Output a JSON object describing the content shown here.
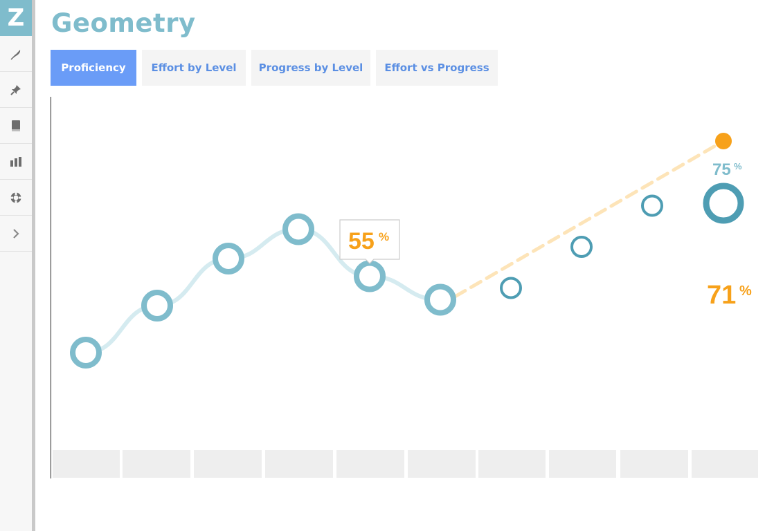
{
  "app": {
    "logo_letter": "Z"
  },
  "page_title": "Geometry",
  "sidebar": {
    "items": [
      {
        "icon": "feather-icon"
      },
      {
        "icon": "pin-icon"
      },
      {
        "icon": "book-icon"
      },
      {
        "icon": "bar-chart-icon"
      },
      {
        "icon": "lifebuoy-icon"
      },
      {
        "icon": "chevron-right-icon"
      }
    ]
  },
  "tabs": [
    {
      "label": "Proficiency",
      "active": true
    },
    {
      "label": "Effort by Level",
      "active": false
    },
    {
      "label": "Progress by Level",
      "active": false
    },
    {
      "label": "Effort vs Progress",
      "active": false
    }
  ],
  "chart_data": {
    "type": "line",
    "series": [
      {
        "role": "actual",
        "values": [
          35,
          43,
          51,
          56,
          48,
          44
        ],
        "color": "#7fbccc"
      },
      {
        "role": "projected",
        "values": [
          46,
          53,
          60,
          71
        ],
        "color": "#f7a11a"
      },
      {
        "role": "target",
        "values": [
          46,
          53,
          60,
          75
        ],
        "color": "#4e9db3"
      }
    ],
    "tooltip": {
      "value": "55",
      "unit": "%"
    },
    "end_labels": {
      "target": {
        "value": "75",
        "unit": "%",
        "color": "#7fbccc"
      },
      "projected": {
        "value": "71",
        "unit": "%",
        "color": "#f7a11a"
      }
    },
    "categories": [
      "",
      "",
      "",
      "",
      "",
      "",
      "",
      "",
      "",
      ""
    ],
    "colors": {
      "actual": "#7fbccc",
      "target": "#4e9db3",
      "projected": "#f7a11a",
      "tooltip_border": "#cccccc"
    }
  }
}
